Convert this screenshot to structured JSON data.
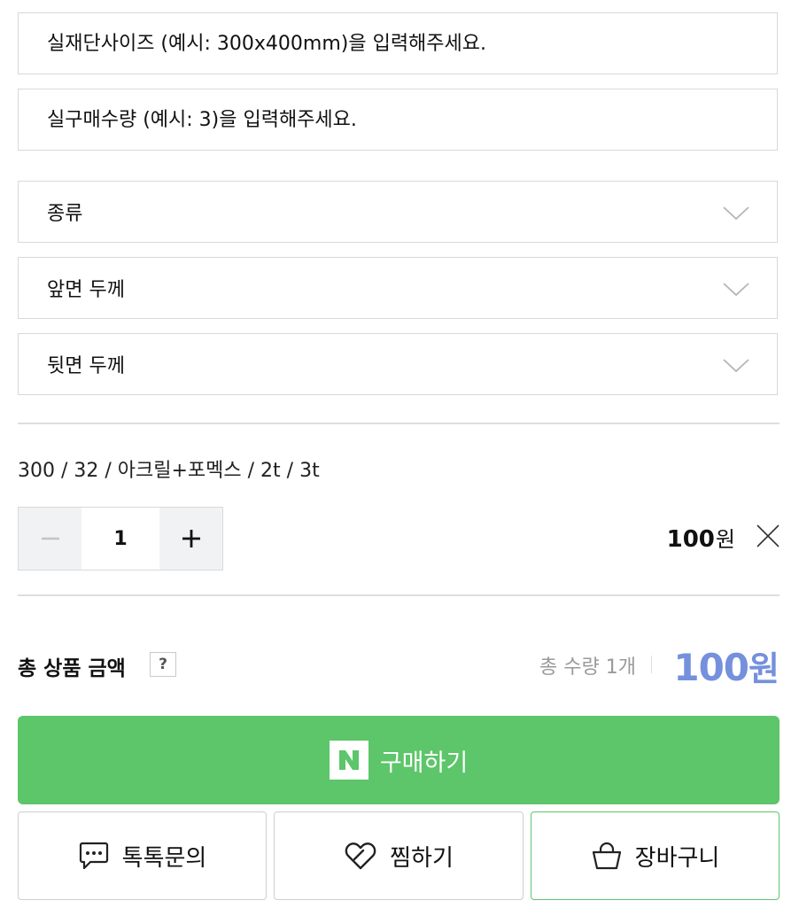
{
  "inputs": {
    "cut_size_placeholder": "실재단사이즈 (예시: 300x400mm)을 입력해주세요.",
    "purchase_qty_placeholder": "실구매수량 (예시: 3)을 입력해주세요."
  },
  "selects": [
    {
      "label": "종류"
    },
    {
      "label": "앞면 두께"
    },
    {
      "label": "뒷면 두께"
    }
  ],
  "selected_option": {
    "summary": "300 / 32 / 아크릴+포멕스 / 2t / 3t",
    "quantity": "1",
    "price_value": "100",
    "price_unit": "원"
  },
  "total": {
    "label": "총 상품 금액",
    "help": "?",
    "quantity_text": "총 수량 1개",
    "price_value": "100",
    "price_unit": "원"
  },
  "actions": {
    "buy_logo": "N",
    "buy_label": "구매하기",
    "talk_label": "톡톡문의",
    "wish_label": "찜하기",
    "cart_label": "장바구니"
  },
  "colors": {
    "npay_green": "#5dc56a",
    "total_price_blue": "#7590dc",
    "border_gray": "#d9d9d9"
  },
  "icons": {
    "select_arrow": "chevron-down-icon",
    "decrease": "minus-icon",
    "increase": "plus-icon",
    "remove": "close-icon",
    "talk": "chat-bubble-icon",
    "wish": "heart-icon",
    "cart": "shopping-bag-icon"
  }
}
